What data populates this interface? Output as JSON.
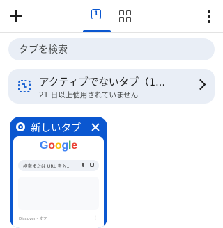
{
  "toolbar": {
    "new_tab_icon": "plus-icon",
    "tab_count": "1",
    "grid_icon": "grid-icon",
    "more_icon": "more-vert-icon"
  },
  "search": {
    "placeholder": "タブを検索"
  },
  "inactive_tabs": {
    "title": "アクティブでないタブ（1...",
    "subtitle": "21 日以上使用されていません",
    "icon": "inactive-tab-icon"
  },
  "tabs": [
    {
      "title": "新しいタブ",
      "favicon": "chrome-icon",
      "preview": {
        "logo": [
          "G",
          "o",
          "o",
          "g",
          "l",
          "e"
        ],
        "search_text": "検索または URL を入...",
        "discover_text": "Discover - オフ"
      }
    }
  ],
  "colors": {
    "accent": "#0b57d0",
    "surface": "#e9eef6"
  }
}
